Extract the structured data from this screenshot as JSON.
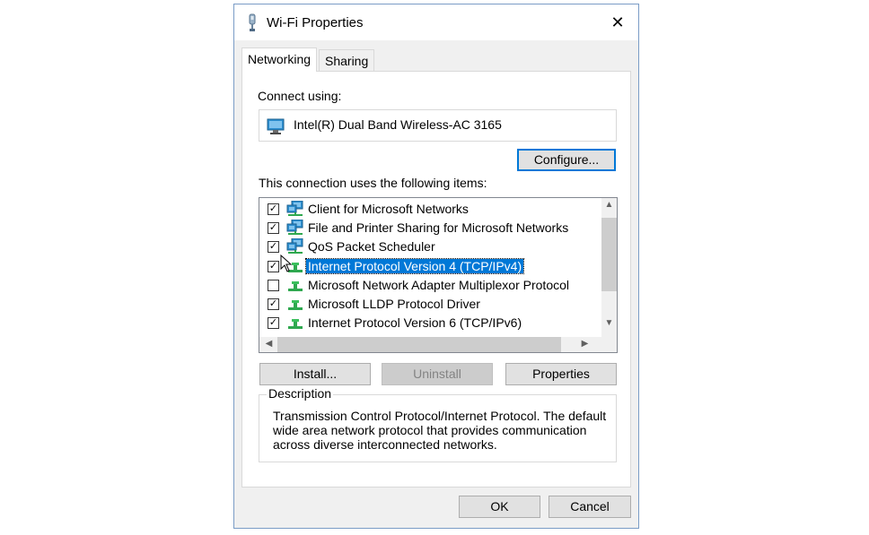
{
  "window": {
    "title": "Wi-Fi Properties",
    "close_glyph": "✕",
    "title_icon": "network-adapter-icon"
  },
  "tabs": [
    {
      "label": "Networking",
      "active": true
    },
    {
      "label": "Sharing",
      "active": false
    }
  ],
  "networking": {
    "connect_using_label": "Connect using:",
    "adapter_name": "Intel(R) Dual Band Wireless-AC 3165",
    "configure_label": "Configure...",
    "items_label": "This connection uses the following items:",
    "items": [
      {
        "label": "Client for Microsoft Networks",
        "checked": true,
        "icon": "network-client-icon",
        "selected": false
      },
      {
        "label": "File and Printer Sharing for Microsoft Networks",
        "checked": true,
        "icon": "network-client-icon",
        "selected": false
      },
      {
        "label": "QoS Packet Scheduler",
        "checked": true,
        "icon": "network-client-icon",
        "selected": false
      },
      {
        "label": "Internet Protocol Version 4 (TCP/IPv4)",
        "checked": true,
        "icon": "protocol-icon",
        "selected": true
      },
      {
        "label": "Microsoft Network Adapter Multiplexor Protocol",
        "checked": false,
        "icon": "protocol-icon",
        "selected": false
      },
      {
        "label": "Microsoft LLDP Protocol Driver",
        "checked": true,
        "icon": "protocol-icon",
        "selected": false
      },
      {
        "label": "Internet Protocol Version 6 (TCP/IPv6)",
        "checked": true,
        "icon": "protocol-icon",
        "selected": false
      }
    ],
    "install_label": "Install...",
    "uninstall_label": "Uninstall",
    "properties_label": "Properties",
    "description_title": "Description",
    "description_text": "Transmission Control Protocol/Internet Protocol. The default wide area network protocol that provides communication across diverse interconnected networks."
  },
  "footer": {
    "ok_label": "OK",
    "cancel_label": "Cancel"
  },
  "colors": {
    "selection": "#0078d7",
    "dialog_border": "#7a9cc6",
    "background": "#f0f0f0"
  }
}
